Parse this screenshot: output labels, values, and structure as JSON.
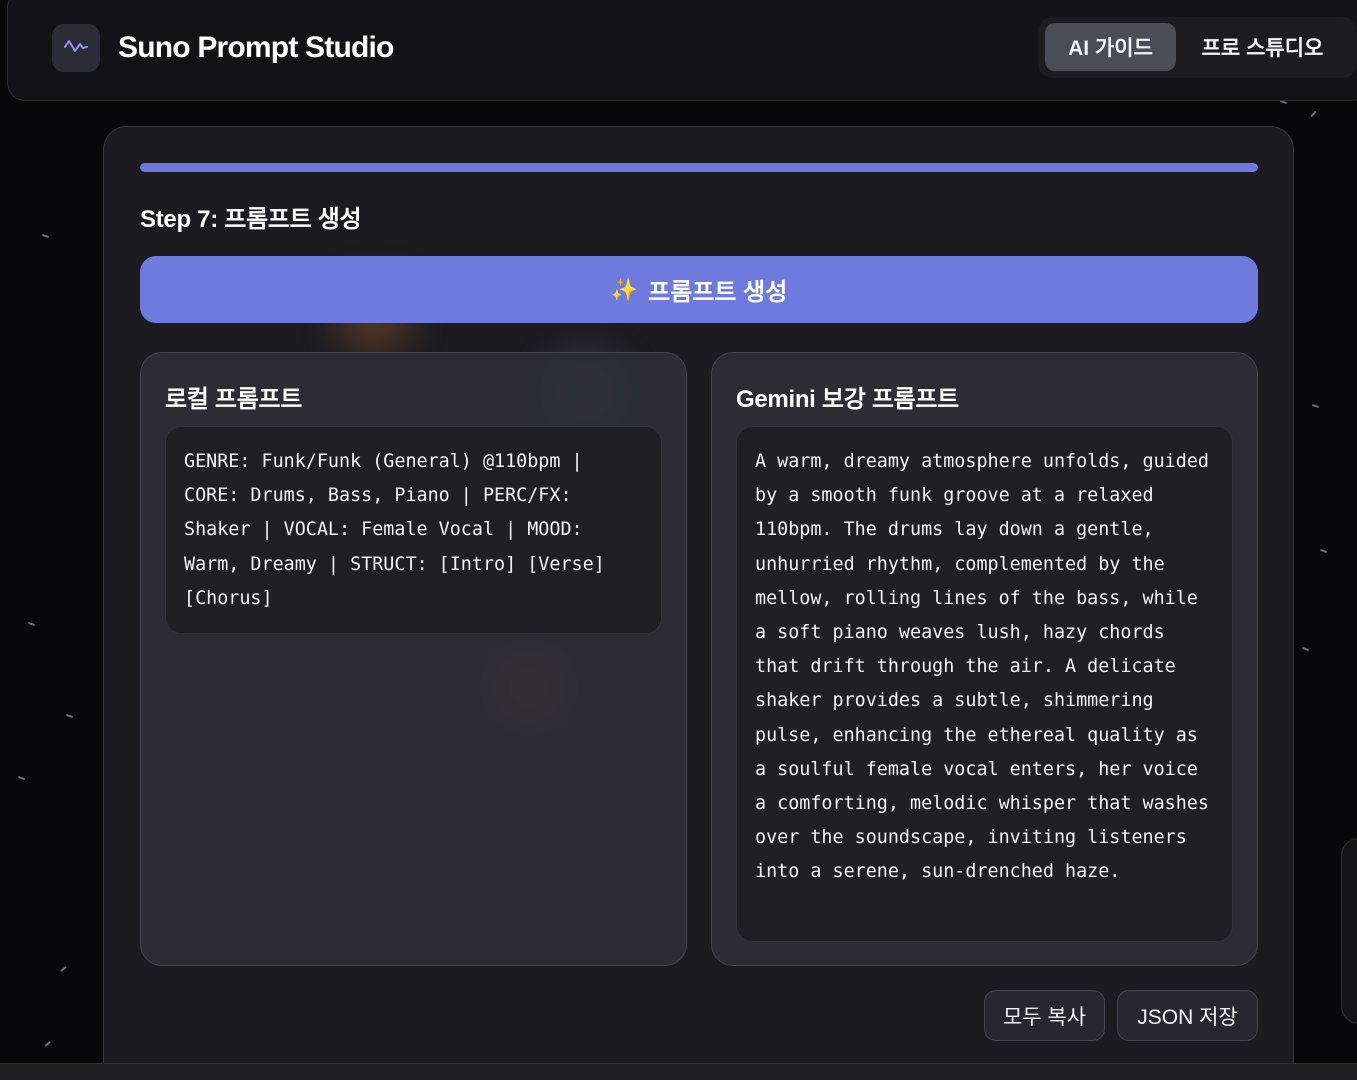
{
  "app": {
    "title": "Suno Prompt Studio",
    "logo_icon": "waveform-icon"
  },
  "mode_switch": {
    "ai_guide_label": "AI 가이드",
    "pro_studio_label": "프로 스튜디오",
    "selected": "AI 가이드"
  },
  "wizard": {
    "progress_fraction": 1.0,
    "step_title": "Step 7: 프롬프트 생성",
    "generate_button_icon": "sparkles-icon",
    "generate_button_label": "프롬프트 생성"
  },
  "local_prompt": {
    "title": "로컬 프롬프트",
    "text": "GENRE: Funk/Funk (General) @110bpm | CORE: Drums, Bass, Piano | PERC/FX: Shaker | VOCAL: Female Vocal | MOOD: Warm, Dreamy | STRUCT: [Intro] [Verse] [Chorus]"
  },
  "gemini_prompt": {
    "title": "Gemini 보강 프롬프트",
    "text": "A warm, dreamy atmosphere unfolds, guided by a smooth funk groove at a relaxed 110bpm. The drums lay down a gentle, unhurried rhythm, complemented by the mellow, rolling lines of the bass, while a soft piano weaves lush, hazy chords that drift through the air. A delicate shaker provides a subtle, shimmering pulse, enhancing the ethereal quality as a soulful female vocal enters, her voice a comforting, melodic whisper that washes over the soundscape, inviting listeners into a serene, sun-drenched haze."
  },
  "actions": {
    "copy_all_label": "모두 복사",
    "save_json_label": "JSON 저장"
  },
  "colors": {
    "accent": "#6f7adf",
    "background": "#08080a",
    "card": "#1b1b20",
    "panel": "#2e2e34"
  }
}
